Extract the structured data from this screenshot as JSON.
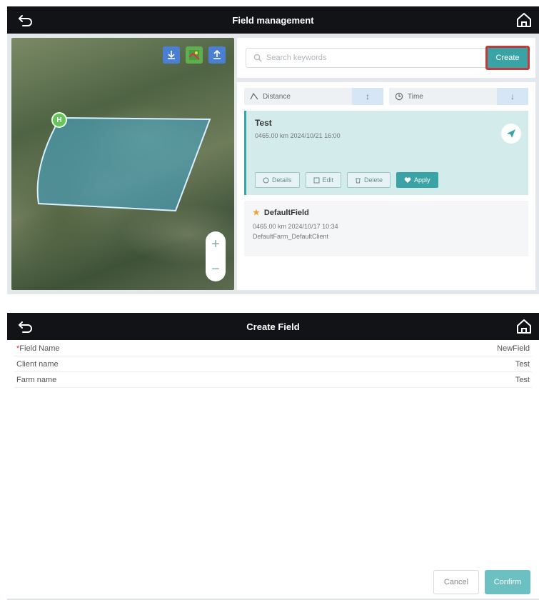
{
  "field_management": {
    "title": "Field management",
    "search_placeholder": "Search keywords",
    "create_label": "Create",
    "sort": {
      "distance_label": "Distance",
      "time_label": "Time"
    },
    "map": {
      "marker_label": "H"
    },
    "fields": [
      {
        "name": "Test",
        "meta": "0465.00 km   2024/10/21 16:00",
        "actions": {
          "details": "Details",
          "edit": "Edit",
          "delete": "Delete",
          "apply": "Apply"
        }
      },
      {
        "name": "DefaultField",
        "meta": "0465.00 km   2024/10/17 10:34",
        "meta2": "DefaultFarm_DefaultClient"
      }
    ]
  },
  "create_field": {
    "title": "Create Field",
    "rows": [
      {
        "label": "Field Name",
        "required": "*",
        "value": "NewField"
      },
      {
        "label": "Client name",
        "value": "Test"
      },
      {
        "label": "Farm name",
        "value": "Test"
      }
    ],
    "cancel_label": "Cancel",
    "confirm_label": "Confirm"
  },
  "colors": {
    "accent": "#3aa3a5",
    "topbar": "#111317",
    "highlight": "#c23a3a"
  }
}
